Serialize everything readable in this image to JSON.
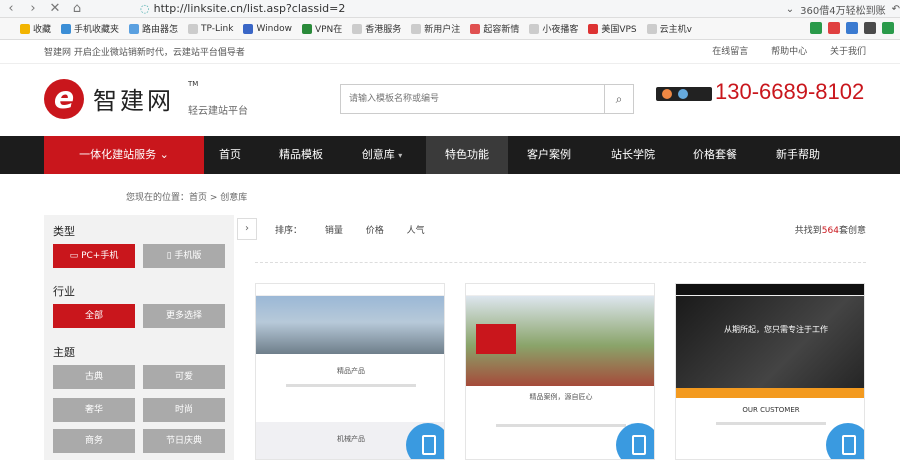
{
  "browser": {
    "url": "http://linksite.cn/list.asp?classid=2",
    "status_text": "360借4万轻松到账"
  },
  "bookmarks": [
    "收藏",
    "手机收藏夹",
    "路由器怎",
    "TP-Link",
    "Window",
    "VPN在",
    "香港服务",
    "新用户注",
    "起容新情",
    "小夜播客",
    "美国VPS",
    "云主机v"
  ],
  "site": {
    "slogan": "智建网  开启企业微站销新时代，云建站平台倡导者",
    "top_links": [
      "在线留言",
      "帮助中心",
      "关于我们"
    ],
    "logo_name": "智建网",
    "logo_tm": "TM",
    "logo_sub": "轻云建站平台",
    "search_placeholder": "请输入模板名称或编号",
    "phone": "130-6689-8102"
  },
  "nav": {
    "first": "一体化建站服务",
    "items": [
      "首页",
      "精品模板",
      "创意库",
      "特色功能",
      "客户案例",
      "站长学院",
      "价格套餐",
      "新手帮助"
    ]
  },
  "breadcrumb": "您现在的位置：首页 > 创意库",
  "sidebar": {
    "type_title": "类型",
    "type_buttons": [
      "PC+手机",
      "手机版"
    ],
    "industry_title": "行业",
    "industry_buttons": [
      "全部",
      "更多选择"
    ],
    "theme_title": "主题",
    "theme_buttons": [
      "古典",
      "可爱",
      "奢华",
      "时尚",
      "商务",
      "节日庆典"
    ]
  },
  "sort": {
    "label": "排序：",
    "options": [
      "销量",
      "价格",
      "人气"
    ],
    "found_prefix": "共找到",
    "found_count": "564",
    "found_suffix": "套创意"
  },
  "cards": [
    {
      "caption": "精品产品",
      "section": "机械产品"
    },
    {
      "caption": "精品案例，源自匠心",
      "section": ""
    },
    {
      "caption": "从期所起，您只需专注于工作",
      "section": "OUR CUSTOMER"
    }
  ]
}
